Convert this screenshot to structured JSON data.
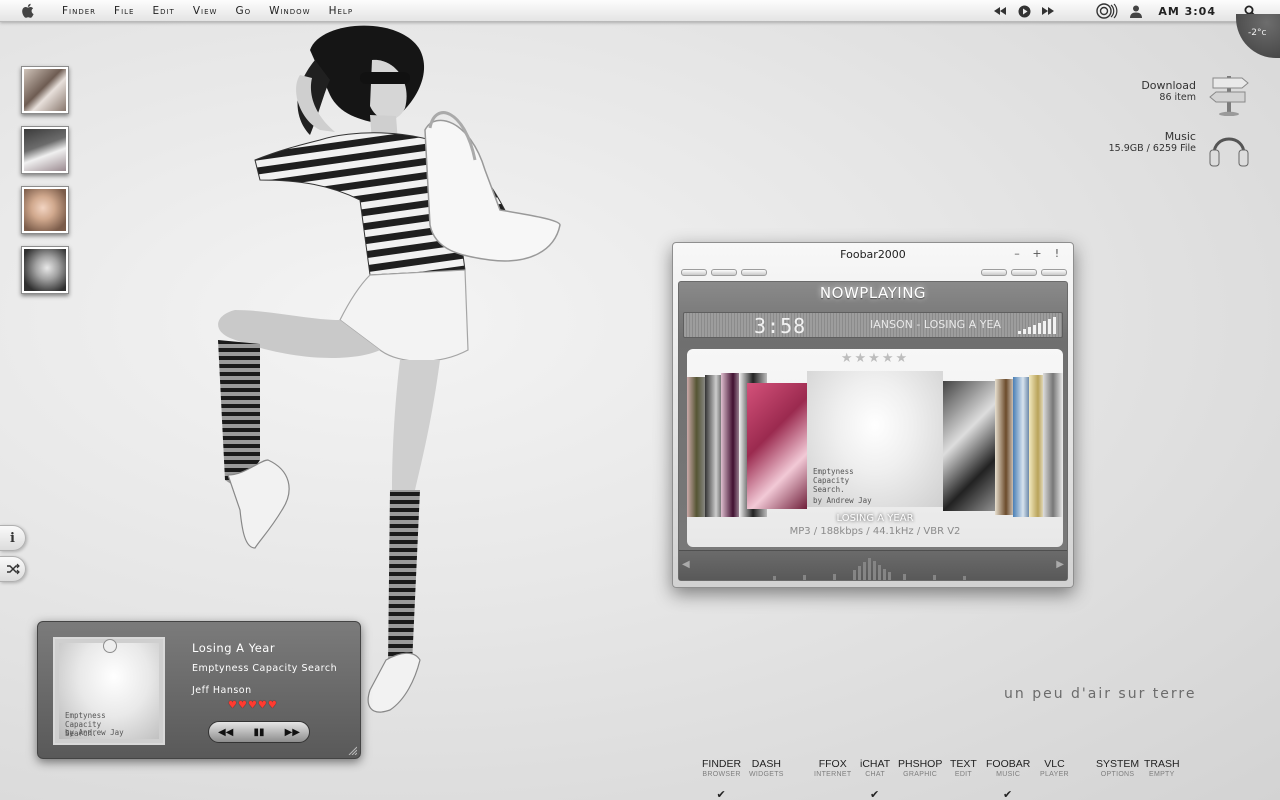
{
  "menubar": {
    "menus": [
      "Finder",
      "File",
      "Edit",
      "View",
      "Go",
      "Window",
      "Help"
    ],
    "clock": "AM 3:04"
  },
  "weather": {
    "temperature": "-2°c"
  },
  "desktop": {
    "download": {
      "title": "Download",
      "subtitle": "86  item"
    },
    "music": {
      "title": "Music",
      "subtitle": "15.9GB / 6259 File"
    },
    "tagline": "un peu d'air sur terre"
  },
  "foobar": {
    "title": "Foobar2000",
    "header": "NOWPLAYING",
    "time": "3:58",
    "scrolling_track": "IANSON - LOSING A YEAR",
    "rating_stars": "★★★★★",
    "current_title": "LOSING A YEAR",
    "format_info": "MP3 / 188kbps / 44.1kHz / VBR V2",
    "cover_text": [
      "Emptyness",
      "Capacity",
      "Search."
    ],
    "cover_author": "by Andrew Jay"
  },
  "mini_player": {
    "track": "Losing A Year",
    "album": "Emptyness Capacity Search",
    "artist": "Jeff Hanson",
    "rating": 5,
    "cover_text": [
      "Emptyness",
      "Capacity",
      "Search."
    ],
    "cover_author": "by Andrew Jay"
  },
  "dock": [
    {
      "label": "FINDER",
      "sub": "BROWSER",
      "checked": true
    },
    {
      "label": "DASH",
      "sub": "WIDGETS",
      "checked": false
    },
    {
      "label": "FFOX",
      "sub": "INTERNET",
      "checked": false
    },
    {
      "label": "iCHAT",
      "sub": "CHAT",
      "checked": true
    },
    {
      "label": "PHSHOP",
      "sub": "GRAPHIC",
      "checked": false
    },
    {
      "label": "TEXT",
      "sub": "EDIT",
      "checked": false
    },
    {
      "label": "FOOBAR",
      "sub": "MUSIC",
      "checked": true
    },
    {
      "label": "VLC",
      "sub": "PLAYER",
      "checked": false
    },
    {
      "label": "SYSTEM",
      "sub": "OPTIONS",
      "checked": false
    },
    {
      "label": "TRASH",
      "sub": "EMPTY",
      "checked": false
    }
  ],
  "colors": {
    "heart": "#ff3b30",
    "panel_dark": "#595959",
    "menubar": "#f0f0f0"
  },
  "icons": {
    "apple": "apple-icon",
    "prev": "previous-track-icon",
    "play": "play-icon",
    "next": "next-track-icon",
    "airport": "wifi-icon",
    "user": "user-icon",
    "spotlight": "search-icon",
    "download": "signpost-icon",
    "music": "headphones-icon",
    "info": "info-icon",
    "shuffle": "shuffle-icon"
  }
}
